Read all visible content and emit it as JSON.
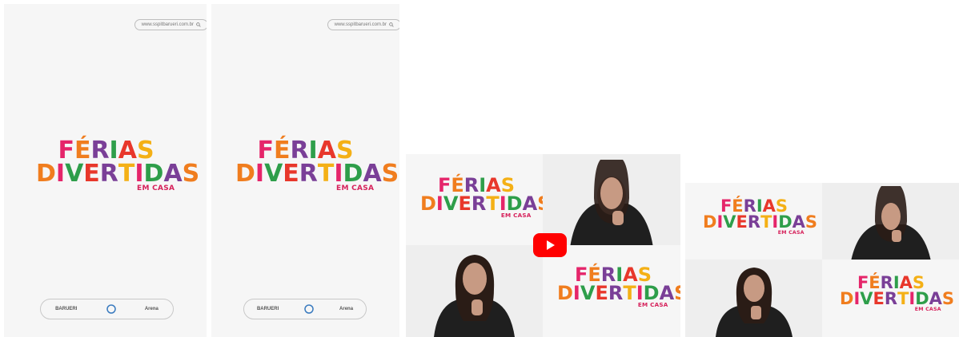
{
  "story_cards": [
    {
      "url": "www.sspitbarueri.com.br",
      "logo": {
        "line1": "FÉRIAS",
        "line2": "DIVERTIDAS",
        "line3": "EM CASA"
      },
      "sponsors": [
        "BARUERI",
        "",
        "Arena"
      ]
    },
    {
      "url": "www.sspitbarueri.com.br",
      "logo": {
        "line1": "FÉRIAS",
        "line2": "DIVERTIDAS",
        "line3": "EM CASA"
      },
      "sponsors": [
        "BARUERI",
        "",
        "Arena"
      ]
    }
  ],
  "video_card": {
    "logo": {
      "line1": "FÉRIAS",
      "line2": "DIVERTIDAS",
      "line3": "EM CASA"
    },
    "play_icon": "youtube-play-icon"
  },
  "collage_card": {
    "logo": {
      "line1": "FÉRIAS",
      "line2": "DIVERTIDAS",
      "line3": "EM CASA"
    }
  },
  "colors": {
    "pink": "#e5256a",
    "orange": "#f07d1e",
    "purple": "#7a3f97",
    "green": "#2e9e4a",
    "red": "#e8372b",
    "yellow": "#f4b016",
    "magenta": "#d6215b"
  }
}
